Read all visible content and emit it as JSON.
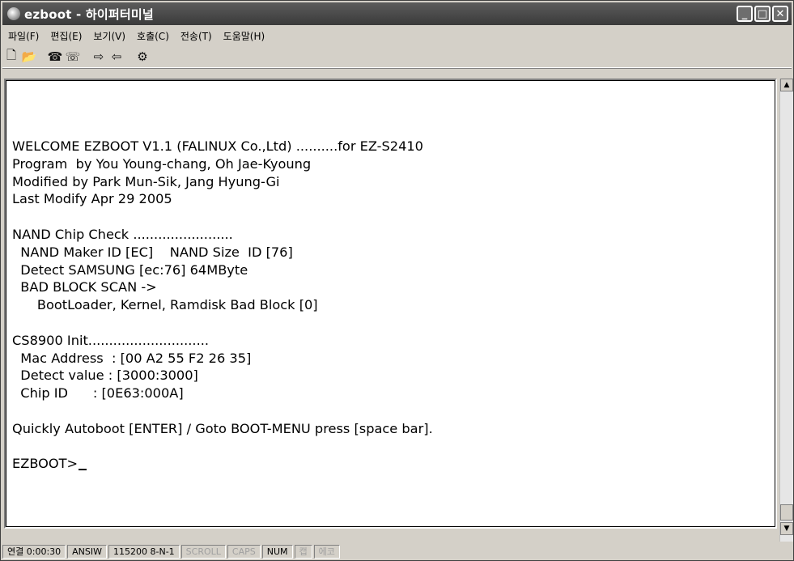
{
  "window": {
    "title": "ezboot - 하이퍼터미널"
  },
  "titlebar": {
    "minimize": "_",
    "maximize": "□",
    "close": "✕"
  },
  "menu": {
    "items": [
      "파일(F)",
      "편집(E)",
      "보기(V)",
      "호출(C)",
      "전송(T)",
      "도움말(H)"
    ]
  },
  "toolbar": {
    "icons": [
      "new-icon",
      "open-icon",
      "phone-icon",
      "disconnect-icon",
      "send-icon",
      "receive-icon",
      "properties-icon"
    ],
    "glyphs": [
      "🗋",
      "📂",
      "☎",
      "☏",
      "⇨",
      "⇦",
      "⚙"
    ]
  },
  "terminal": {
    "lines": [
      "WELCOME EZBOOT V1.1 (FALINUX Co.,Ltd) ..........for EZ-S2410",
      "Program  by You Young-chang, Oh Jae-Kyoung",
      "Modified by Park Mun-Sik, Jang Hyung-Gi",
      "Last Modify Apr 29 2005",
      "",
      "NAND Chip Check ........................",
      "  NAND Maker ID [EC]    NAND Size  ID [76]",
      "  Detect SAMSUNG [ec:76] 64MByte",
      "  BAD BLOCK SCAN ->",
      "      BootLoader, Kernel, Ramdisk Bad Block [0]",
      "",
      "CS8900 Init.............................",
      "  Mac Address  : [00 A2 55 F2 26 35]",
      "  Detect value : [3000:3000]",
      "  Chip ID      : [0E63:000A]",
      "",
      "Quickly Autoboot [ENTER] / Goto BOOT-MENU press [space bar].",
      ""
    ],
    "prompt": "EZBOOT>"
  },
  "scrollbar": {
    "up": "▲",
    "down": "▼"
  },
  "status": {
    "connected": "연결 0:00:30",
    "emulation": "ANSIW",
    "port": "115200 8-N-1",
    "scroll": "SCROLL",
    "caps": "CAPS",
    "num": "NUM",
    "capture": "캡",
    "echo": "에코"
  }
}
